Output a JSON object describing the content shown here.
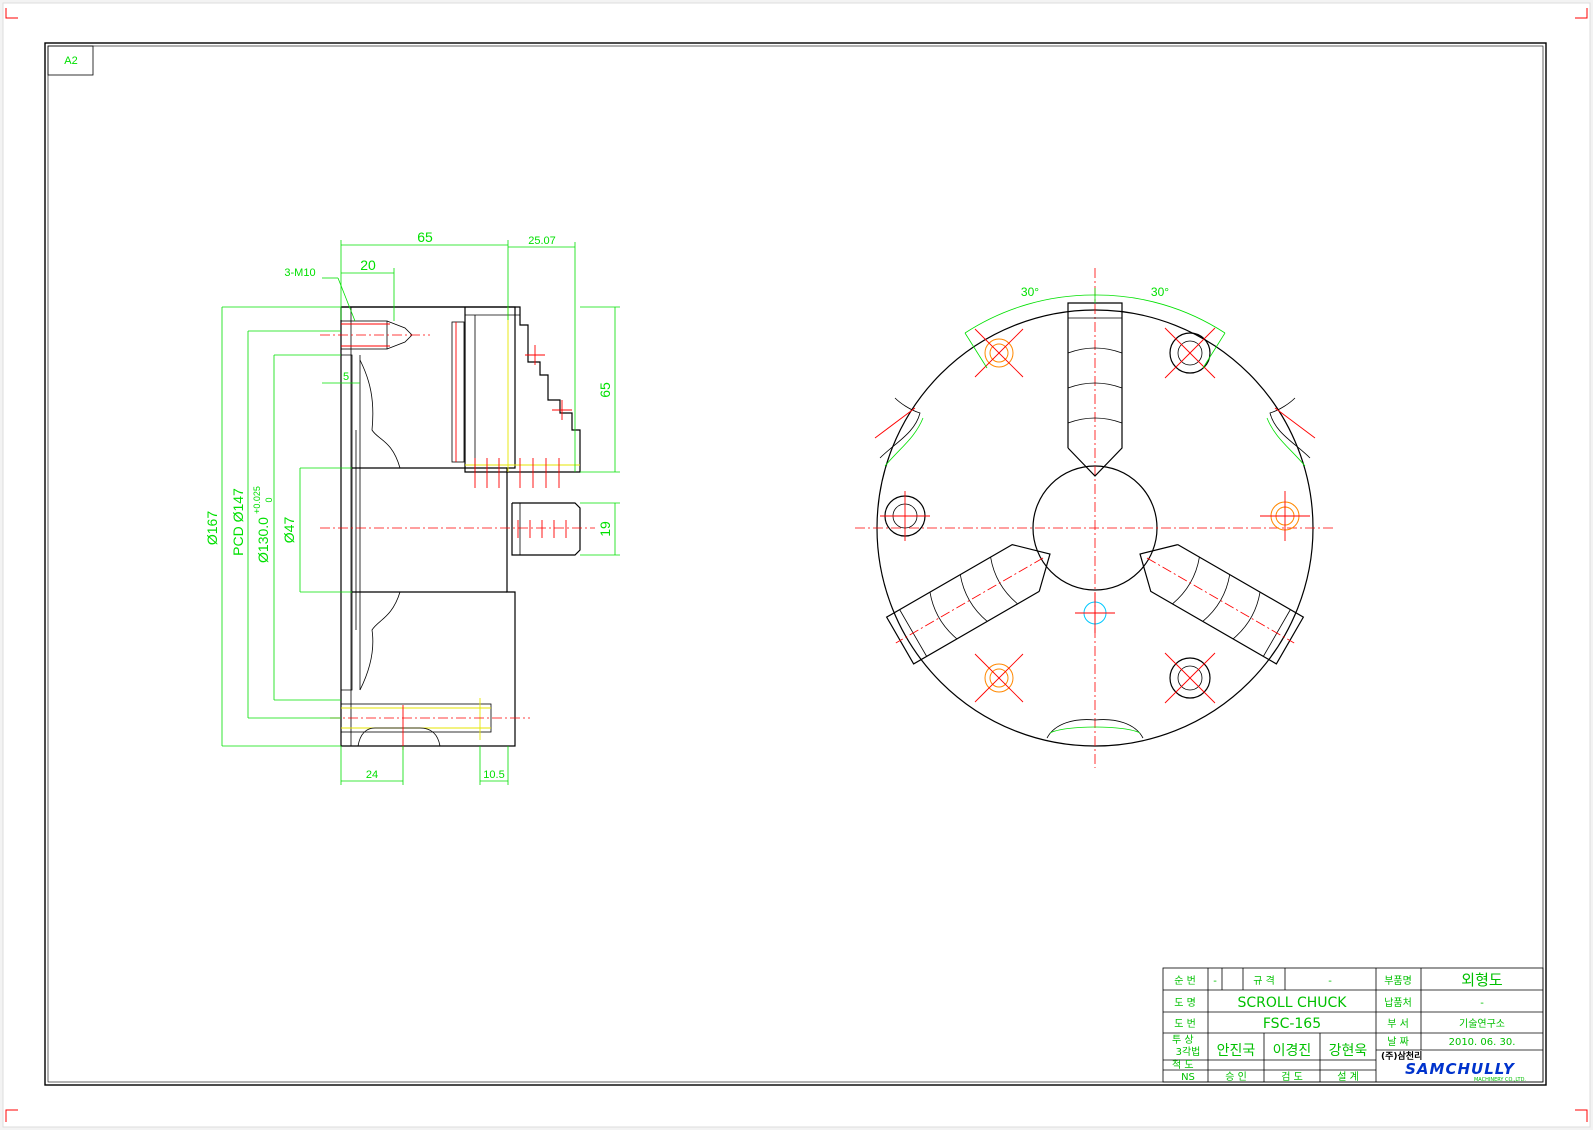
{
  "sheet": {
    "size_tag": "A2"
  },
  "dimensions": {
    "top_65": "65",
    "top_25_07": "25.07",
    "hole_callout": "3-M10",
    "d20": "20",
    "d5": "5",
    "right_65": "65",
    "right_19": "19",
    "d167": "Ø167",
    "pcd147": "PCD Ø147",
    "d130": "Ø130.0",
    "d130_tol_upper": "+0.025",
    "d130_tol_lower": "0",
    "d47": "Ø47",
    "bottom_24": "24",
    "bottom_10_5": "10.5",
    "angle_left": "30°",
    "angle_right": "30°"
  },
  "title_block": {
    "row1": {
      "label_a": "순  번",
      "val_a": "-",
      "label_b": "규  격",
      "val_b": "-",
      "label_c": "부품명",
      "val_c": "외형도"
    },
    "row2": {
      "label_a": "도  명",
      "val_a": "SCROLL CHUCK",
      "label_c": "납품처",
      "val_c": "-"
    },
    "row3": {
      "label_a": "도  번",
      "val_a": "FSC-165",
      "label_c": "부  서",
      "val_c": "기술연구소"
    },
    "row4": {
      "label_a": "투 상",
      "val_a": "3각법",
      "approve": "안진국",
      "review": "이경진",
      "design": "강현욱",
      "label_c": "날  짜",
      "val_c": "2010. 06. 30."
    },
    "row5": {
      "label_a": "척 도",
      "val_a": "NS",
      "approve_label": "승   인",
      "review_label": "검   도",
      "design_label": "설   계"
    },
    "company_korean": "(주)삼천리",
    "company_logo": "SAMCHULLY",
    "company_sub": "MACHINERY CO.,LTD."
  }
}
